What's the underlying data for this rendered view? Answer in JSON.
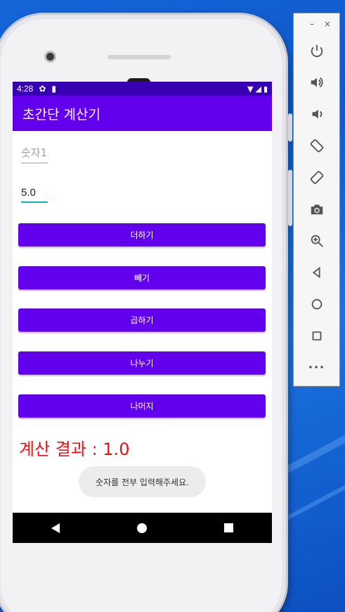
{
  "app": {
    "title": "초간단 계산기"
  },
  "status_bar": {
    "time": "4:28"
  },
  "inputs": {
    "num1": {
      "placeholder": "숫자1",
      "value": ""
    },
    "num2": {
      "value": "5.0"
    }
  },
  "buttons": {
    "add": "더하기",
    "sub": "빼기",
    "mul": "곱하기",
    "div": "나누기",
    "mod": "나머지"
  },
  "result": {
    "text": "계산 결과 : 1.0"
  },
  "toast": {
    "text": "숫자를 전부 입력해주세요."
  },
  "emulator_toolbar": {
    "minimize": "–",
    "close": "×",
    "items": [
      "power-icon",
      "volume-up-icon",
      "volume-down-icon",
      "rotate-left-icon",
      "rotate-right-icon",
      "camera-icon",
      "zoom-icon",
      "back-icon",
      "home-icon",
      "overview-icon",
      "more-icon"
    ],
    "more": "•••"
  },
  "colors": {
    "primary": "#6200ee",
    "primary_dark": "#3700b3",
    "result": "#ee1111",
    "accent": "#00b8c4"
  }
}
